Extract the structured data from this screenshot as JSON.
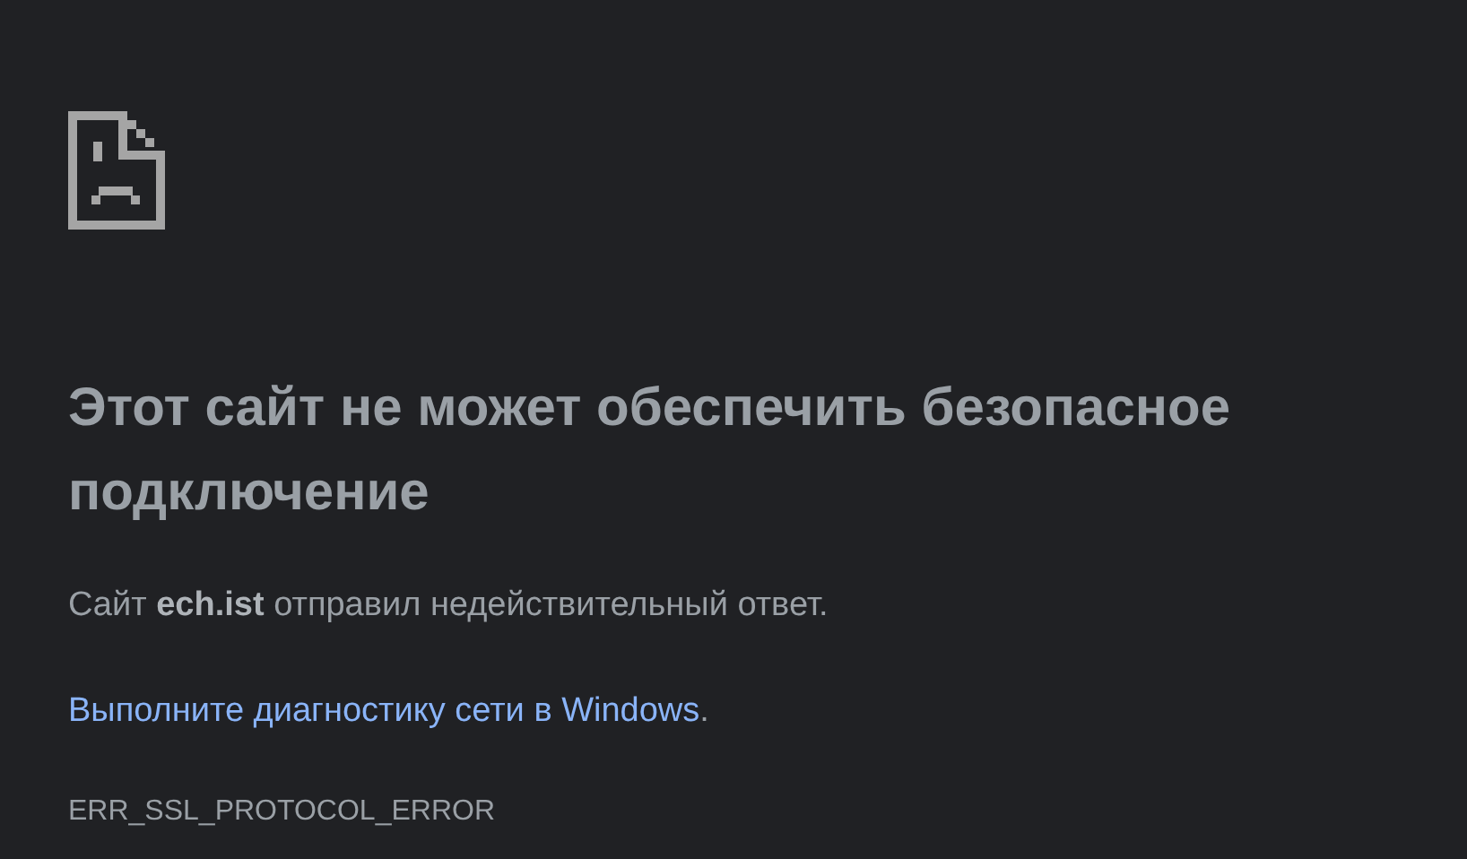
{
  "heading": "Этот сайт не может обеспечить безопасное подключение",
  "message": "Сайт **ech.ist** отправил недействительный ответ.",
  "diagnostics": {
    "link": "Выполните диагностику сети в Windows",
    "suffix": "."
  },
  "error_code": "ERR_SSL_PROTOCOL_ERROR"
}
